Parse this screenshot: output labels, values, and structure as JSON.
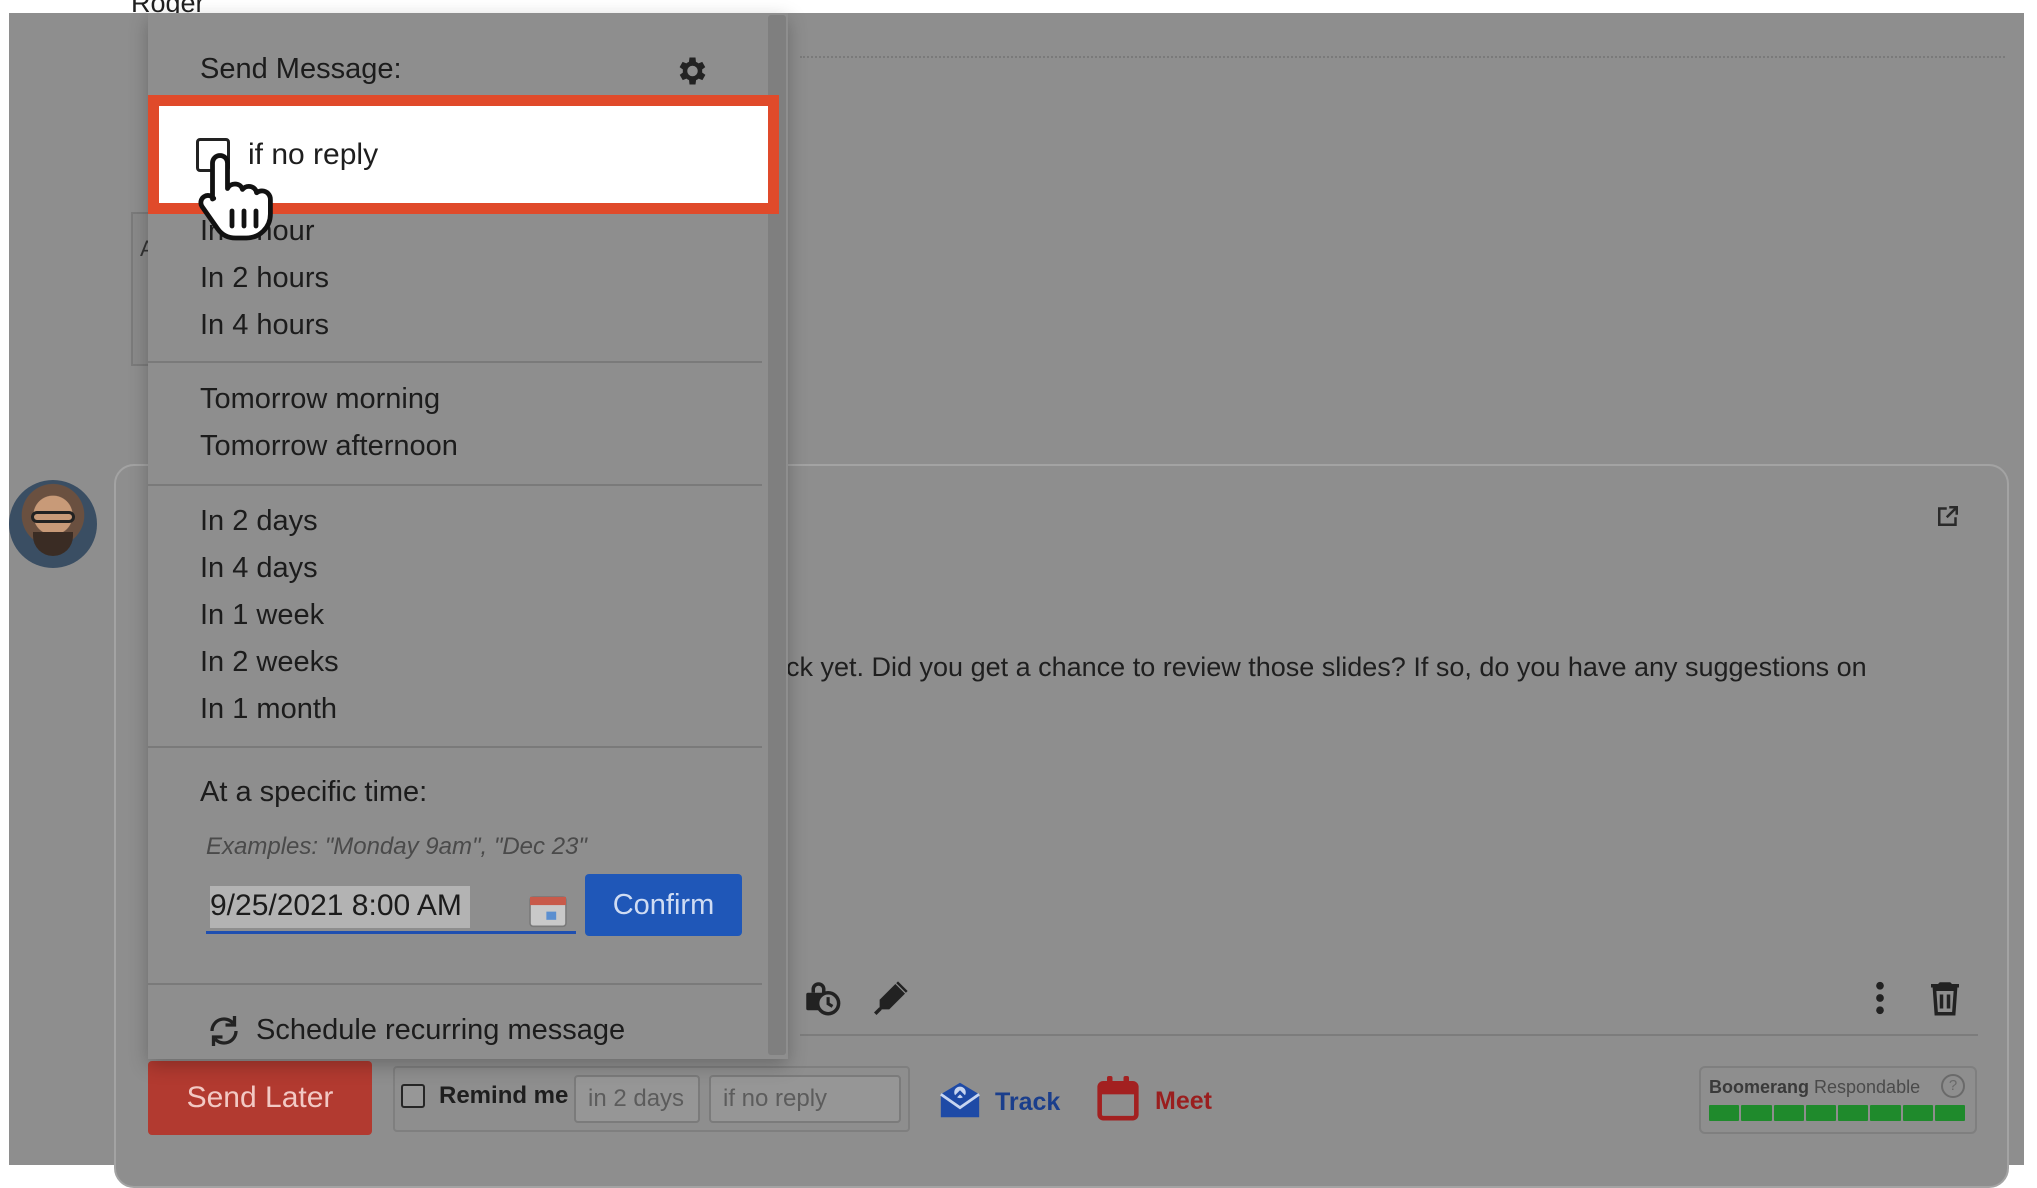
{
  "thread": {
    "sender_name": "Roger",
    "left_card_char": "A",
    "body_text_fragment": "ck yet. Did you get a chance to review those slides? If so, do you have any suggestions on"
  },
  "menu": {
    "title": "Send Message:",
    "highlight_option": "if no reply",
    "items_group1": [
      "In 1 hour",
      "In 2 hours",
      "In 4 hours"
    ],
    "items_group2": [
      "Tomorrow morning",
      "Tomorrow afternoon"
    ],
    "items_group3": [
      "In 2 days",
      "In 4 days",
      "In 1 week",
      "In 2 weeks",
      "In 1 month"
    ],
    "specific_time_label": "At a specific time:",
    "examples": "Examples: \"Monday 9am\", \"Dec 23\"",
    "time_value": "9/25/2021 8:00 AM",
    "confirm_label": "Confirm",
    "recurring_label": "Schedule recurring message"
  },
  "bottom_bar": {
    "send_later_label": "Send Later",
    "remind_label": "Remind me",
    "remind_days": "in 2 days",
    "remind_condition": "if no reply",
    "track_label": "Track",
    "meet_label": "Meet",
    "boomerang_brand": "Boomerang",
    "boomerang_product": "Respondable",
    "boomerang_help": "?"
  },
  "icons": [
    "gear-icon",
    "hand-cursor-icon",
    "calendar-icon",
    "refresh-icon",
    "popout-icon",
    "lock-clock-icon",
    "pen-icon",
    "more-vert-icon",
    "trash-icon",
    "track-envelope-icon",
    "meet-calendar-icon"
  ],
  "colors": {
    "send_later": "#b23a30",
    "confirm": "#1f57b8",
    "highlight_border": "#e04a2a",
    "meter": "#1f8a2c",
    "track": "#1a3e8c",
    "meet": "#9a1e1e"
  }
}
